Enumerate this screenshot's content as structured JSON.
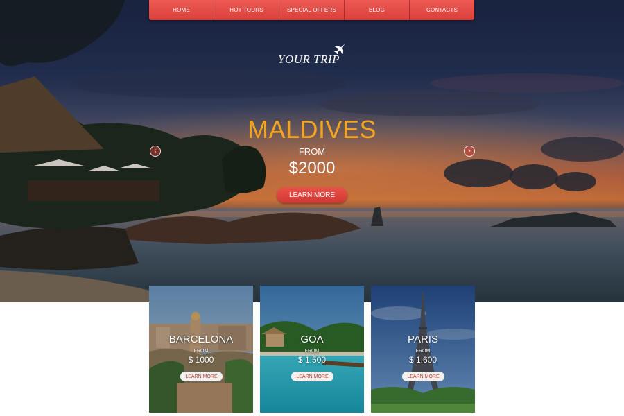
{
  "nav": {
    "items": [
      "HOME",
      "HOT TOURS",
      "SPECIAL OFFERS",
      "BLOG",
      "CONTACTS"
    ]
  },
  "logo": {
    "text": "YOUR TRIP",
    "icon": "airplane-icon"
  },
  "hero": {
    "title": "MALDIVES",
    "from": "FROM",
    "price": "$2000",
    "button": "LEARN MORE",
    "prev_icon": "chevron-left-icon",
    "next_icon": "chevron-right-icon"
  },
  "cards": [
    {
      "title": "BARCELONA",
      "from": "FROM",
      "price": "$ 1000",
      "button": "LEARN MORE"
    },
    {
      "title": "GOA",
      "from": "FROM",
      "price": "$ 1.500",
      "button": "LEARN MORE"
    },
    {
      "title": "PARIS",
      "from": "FROM",
      "price": "$ 1.600",
      "button": "LEARN MORE"
    }
  ],
  "colors": {
    "accent": "#e2463f",
    "title": "#f4a51f",
    "button_text": "#c0392b"
  }
}
